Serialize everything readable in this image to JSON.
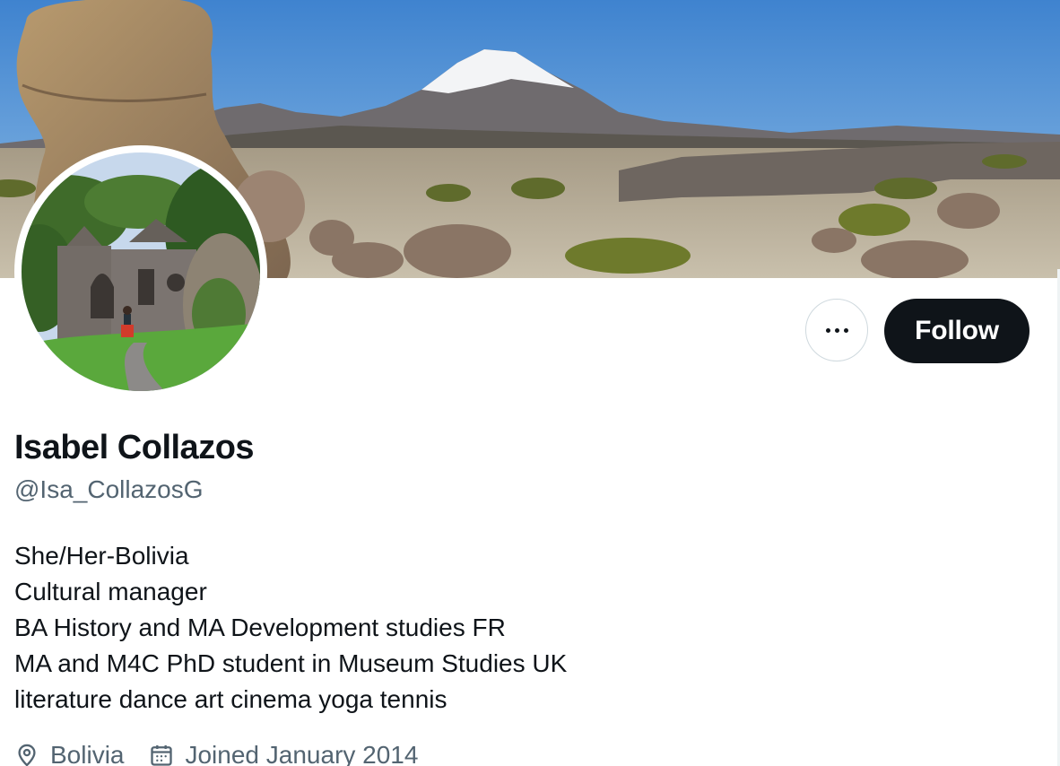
{
  "profile": {
    "display_name": "Isabel Collazos",
    "handle": "@Isa_CollazosG",
    "bio_lines": [
      "She/Her-Bolivia",
      "Cultural manager",
      "BA History and MA Development studies FR",
      "MA and M4C PhD student in Museum Studies UK",
      "literature dance art cinema yoga tennis"
    ],
    "location": "Bolivia",
    "joined": "Joined January 2014"
  },
  "actions": {
    "more_icon": "ellipsis-icon",
    "follow_label": "Follow"
  },
  "icons": {
    "location": "location-pin-icon",
    "joined": "calendar-icon"
  },
  "colors": {
    "primary_text": "#0f1419",
    "secondary_text": "#536471",
    "follow_bg": "#0f1419",
    "border": "#cfd9de"
  }
}
